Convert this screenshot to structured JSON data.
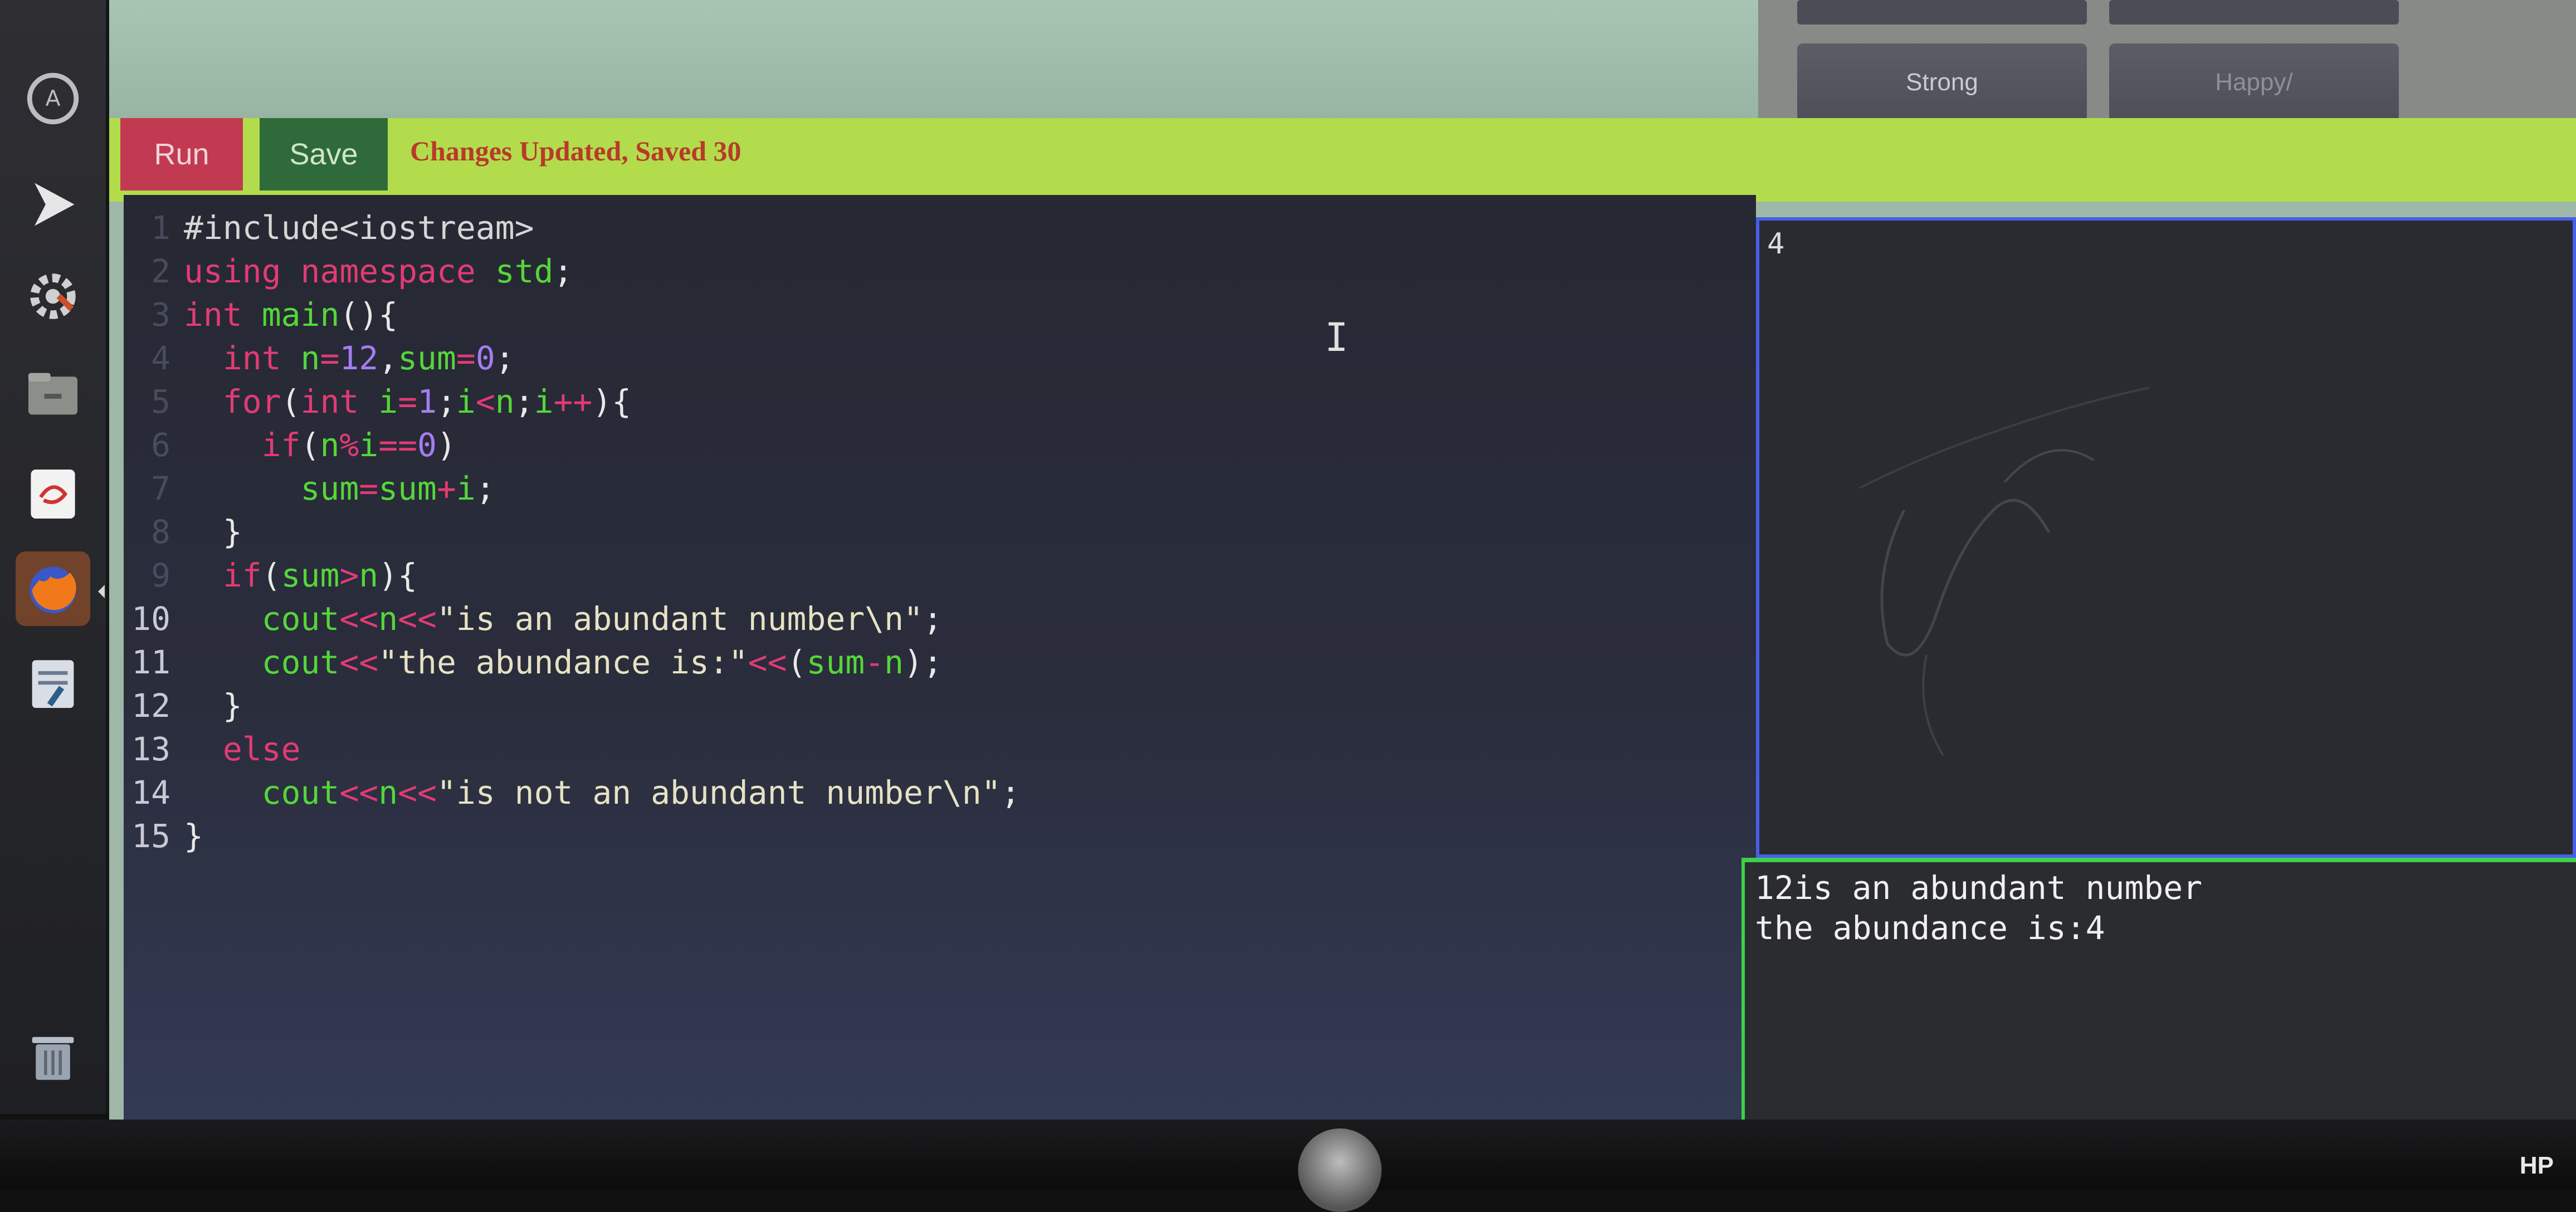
{
  "toolbar": {
    "run_label": "Run",
    "save_label": "Save",
    "status_text": "Changes Updated, Saved 30"
  },
  "top_right": {
    "buttons": [
      "Strong",
      "Happy/"
    ]
  },
  "editor": {
    "lines": [
      {
        "num": "1",
        "tokens": [
          {
            "t": "#include<iostream>",
            "c": "t-pre"
          }
        ]
      },
      {
        "num": "2",
        "tokens": [
          {
            "t": "using namespace ",
            "c": "t-key"
          },
          {
            "t": "std",
            "c": "t-grn"
          },
          {
            "t": ";",
            "c": "t-plain"
          }
        ]
      },
      {
        "num": "3",
        "tokens": [
          {
            "t": "int ",
            "c": "t-key"
          },
          {
            "t": "main",
            "c": "t-grn"
          },
          {
            "t": "(){",
            "c": "t-plain"
          }
        ]
      },
      {
        "num": "4",
        "tokens": [
          {
            "t": "  int ",
            "c": "t-key"
          },
          {
            "t": "n",
            "c": "t-grn"
          },
          {
            "t": "=",
            "c": "t-key"
          },
          {
            "t": "12",
            "c": "t-pur"
          },
          {
            "t": ",",
            "c": "t-plain"
          },
          {
            "t": "sum",
            "c": "t-grn"
          },
          {
            "t": "=",
            "c": "t-key"
          },
          {
            "t": "0",
            "c": "t-pur"
          },
          {
            "t": ";",
            "c": "t-plain"
          }
        ]
      },
      {
        "num": "5",
        "tokens": [
          {
            "t": "  for",
            "c": "t-key"
          },
          {
            "t": "(",
            "c": "t-plain"
          },
          {
            "t": "int ",
            "c": "t-key"
          },
          {
            "t": "i",
            "c": "t-grn"
          },
          {
            "t": "=",
            "c": "t-key"
          },
          {
            "t": "1",
            "c": "t-pur"
          },
          {
            "t": ";",
            "c": "t-plain"
          },
          {
            "t": "i",
            "c": "t-grn"
          },
          {
            "t": "<",
            "c": "t-key"
          },
          {
            "t": "n",
            "c": "t-grn"
          },
          {
            "t": ";",
            "c": "t-plain"
          },
          {
            "t": "i",
            "c": "t-grn"
          },
          {
            "t": "++",
            "c": "t-key"
          },
          {
            "t": "){",
            "c": "t-plain"
          }
        ]
      },
      {
        "num": "6",
        "tokens": [
          {
            "t": "    if",
            "c": "t-key"
          },
          {
            "t": "(",
            "c": "t-plain"
          },
          {
            "t": "n",
            "c": "t-grn"
          },
          {
            "t": "%",
            "c": "t-key"
          },
          {
            "t": "i",
            "c": "t-grn"
          },
          {
            "t": "==",
            "c": "t-key"
          },
          {
            "t": "0",
            "c": "t-pur"
          },
          {
            "t": ")",
            "c": "t-plain"
          }
        ]
      },
      {
        "num": "7",
        "tokens": [
          {
            "t": "      sum",
            "c": "t-grn"
          },
          {
            "t": "=",
            "c": "t-key"
          },
          {
            "t": "sum",
            "c": "t-grn"
          },
          {
            "t": "+",
            "c": "t-key"
          },
          {
            "t": "i",
            "c": "t-grn"
          },
          {
            "t": ";",
            "c": "t-plain"
          }
        ]
      },
      {
        "num": "8",
        "tokens": [
          {
            "t": "  }",
            "c": "t-plain"
          }
        ]
      },
      {
        "num": "9",
        "tokens": [
          {
            "t": "  if",
            "c": "t-key"
          },
          {
            "t": "(",
            "c": "t-plain"
          },
          {
            "t": "sum",
            "c": "t-grn"
          },
          {
            "t": ">",
            "c": "t-key"
          },
          {
            "t": "n",
            "c": "t-grn"
          },
          {
            "t": "){",
            "c": "t-plain"
          }
        ]
      },
      {
        "num": "10",
        "tokens": [
          {
            "t": "    cout",
            "c": "t-grn"
          },
          {
            "t": "<<",
            "c": "t-key"
          },
          {
            "t": "n",
            "c": "t-grn"
          },
          {
            "t": "<<",
            "c": "t-key"
          },
          {
            "t": "\"is an abundant number\\n\"",
            "c": "t-str"
          },
          {
            "t": ";",
            "c": "t-plain"
          }
        ]
      },
      {
        "num": "11",
        "tokens": [
          {
            "t": "    cout",
            "c": "t-grn"
          },
          {
            "t": "<<",
            "c": "t-key"
          },
          {
            "t": "\"the abundance is:\"",
            "c": "t-str"
          },
          {
            "t": "<<",
            "c": "t-key"
          },
          {
            "t": "(",
            "c": "t-plain"
          },
          {
            "t": "sum",
            "c": "t-grn"
          },
          {
            "t": "-",
            "c": "t-key"
          },
          {
            "t": "n",
            "c": "t-grn"
          },
          {
            "t": ");",
            "c": "t-plain"
          }
        ]
      },
      {
        "num": "12",
        "tokens": [
          {
            "t": "  }",
            "c": "t-plain"
          }
        ]
      },
      {
        "num": "13",
        "tokens": [
          {
            "t": "  else",
            "c": "t-key"
          }
        ]
      },
      {
        "num": "14",
        "tokens": [
          {
            "t": "    cout",
            "c": "t-grn"
          },
          {
            "t": "<<",
            "c": "t-key"
          },
          {
            "t": "n",
            "c": "t-grn"
          },
          {
            "t": "<<",
            "c": "t-key"
          },
          {
            "t": "\"is not an abundant number\\n\"",
            "c": "t-str"
          },
          {
            "t": ";",
            "c": "t-plain"
          }
        ]
      },
      {
        "num": "15",
        "tokens": [
          {
            "t": "}",
            "c": "t-plain"
          }
        ]
      }
    ]
  },
  "input": {
    "value": "4"
  },
  "output": {
    "lines": [
      "12is an abundant number",
      "the abundance is:4"
    ]
  },
  "monitor": {
    "brand": "HP"
  },
  "dock": {
    "icons": [
      "software-updater-icon",
      "media-player-icon",
      "settings-icon",
      "files-icon",
      "text-editor-icon",
      "firefox-icon",
      "notes-icon",
      "trash-icon"
    ]
  },
  "colors": {
    "toolbar_bg": "#b2dc4c",
    "run_bg": "#c23a52",
    "save_bg": "#2f6b3a",
    "status_text": "#b83a2a",
    "input_border": "#4860e8",
    "output_border": "#3ed04a"
  }
}
